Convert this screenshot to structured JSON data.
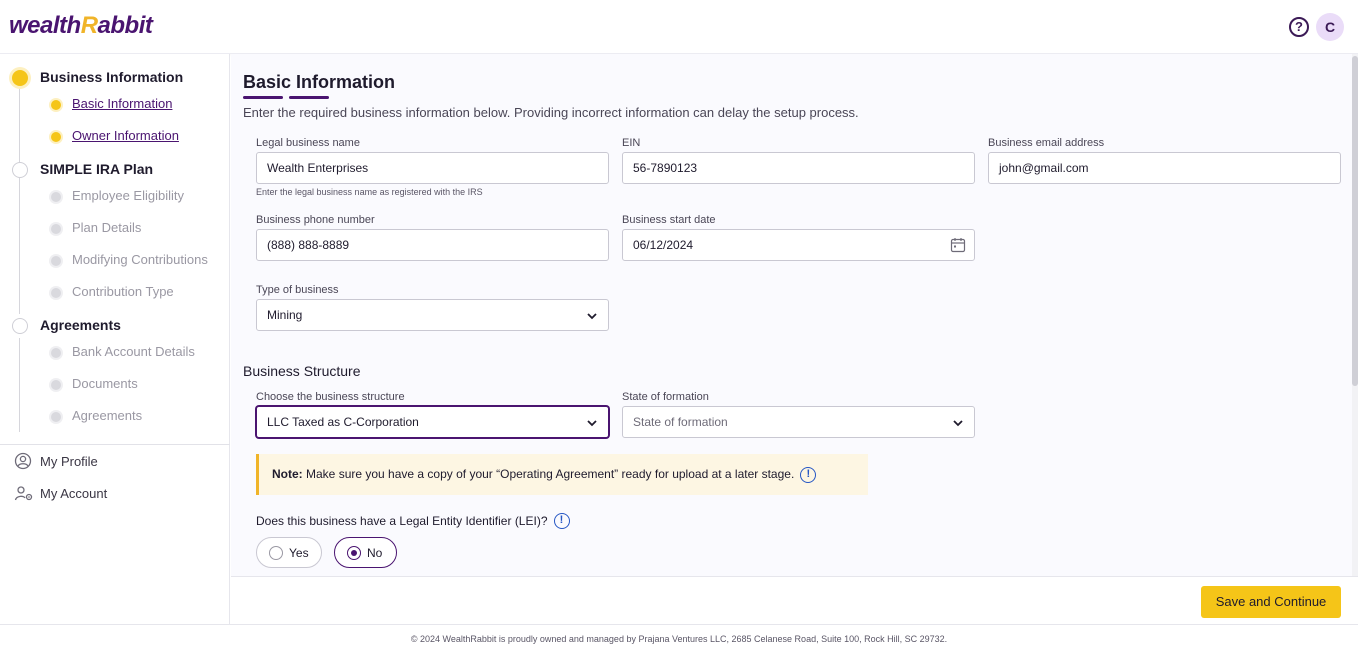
{
  "app": {
    "logo_prefix": "wealth",
    "logo_r": "R",
    "logo_suffix": "abbit",
    "help_icon": "?",
    "avatar_initial": "C"
  },
  "sidebar": {
    "steps": [
      {
        "label": "Business Information",
        "state": "active",
        "items": [
          {
            "label": "Basic Information",
            "state": "active"
          },
          {
            "label": "Owner Information",
            "state": "active"
          }
        ]
      },
      {
        "label": "SIMPLE IRA Plan",
        "state": "idle",
        "items": [
          {
            "label": "Employee Eligibility",
            "state": "idle"
          },
          {
            "label": "Plan Details",
            "state": "idle"
          },
          {
            "label": "Modifying Contributions",
            "state": "idle"
          },
          {
            "label": "Contribution Type",
            "state": "idle"
          }
        ]
      },
      {
        "label": "Agreements",
        "state": "idle",
        "items": [
          {
            "label": "Bank Account Details",
            "state": "idle"
          },
          {
            "label": "Documents",
            "state": "idle"
          },
          {
            "label": "Agreements",
            "state": "idle"
          }
        ]
      }
    ],
    "links": [
      {
        "label": "My Profile",
        "icon": "user-circle-icon"
      },
      {
        "label": "My Account",
        "icon": "user-gear-icon"
      }
    ]
  },
  "main": {
    "title": "Basic Information",
    "subtitle": "Enter the required business information below. Providing incorrect information can delay the setup process.",
    "fields": {
      "legal_name": {
        "label": "Legal business name",
        "value": "Wealth Enterprises",
        "hint": "Enter the legal business name as registered with the IRS"
      },
      "ein": {
        "label": "EIN",
        "value": "56-7890123"
      },
      "email": {
        "label": "Business email address",
        "value": "john@gmail.com"
      },
      "phone": {
        "label": "Business phone number",
        "value": "(888) 888-8889"
      },
      "start_date": {
        "label": "Business start date",
        "value": "06/12/2024"
      },
      "type": {
        "label": "Type of business",
        "value": "Mining"
      }
    },
    "structure": {
      "section_title": "Business Structure",
      "choose": {
        "label": "Choose the business structure",
        "value": "LLC Taxed as C-Corporation"
      },
      "state": {
        "label": "State of formation",
        "placeholder": "State of formation"
      }
    },
    "note": {
      "bold": "Note:",
      "text": "Make sure you have a copy of your “Operating Agreement” ready for upload at a later stage."
    },
    "lei": {
      "question": "Does this business have a Legal Entity Identifier (LEI)?",
      "options": [
        "Yes",
        "No"
      ],
      "selected": "No"
    }
  },
  "footer": {
    "save_label": "Save and Continue",
    "copyright": "© 2024 WealthRabbit is proudly owned and managed by Prajana Ventures LLC, 2685 Celanese Road, Suite 100, Rock Hill, SC 29732."
  },
  "colors": {
    "brand_purple": "#4a1470",
    "accent_yellow": "#f5c518",
    "info_blue": "#2657c4"
  }
}
